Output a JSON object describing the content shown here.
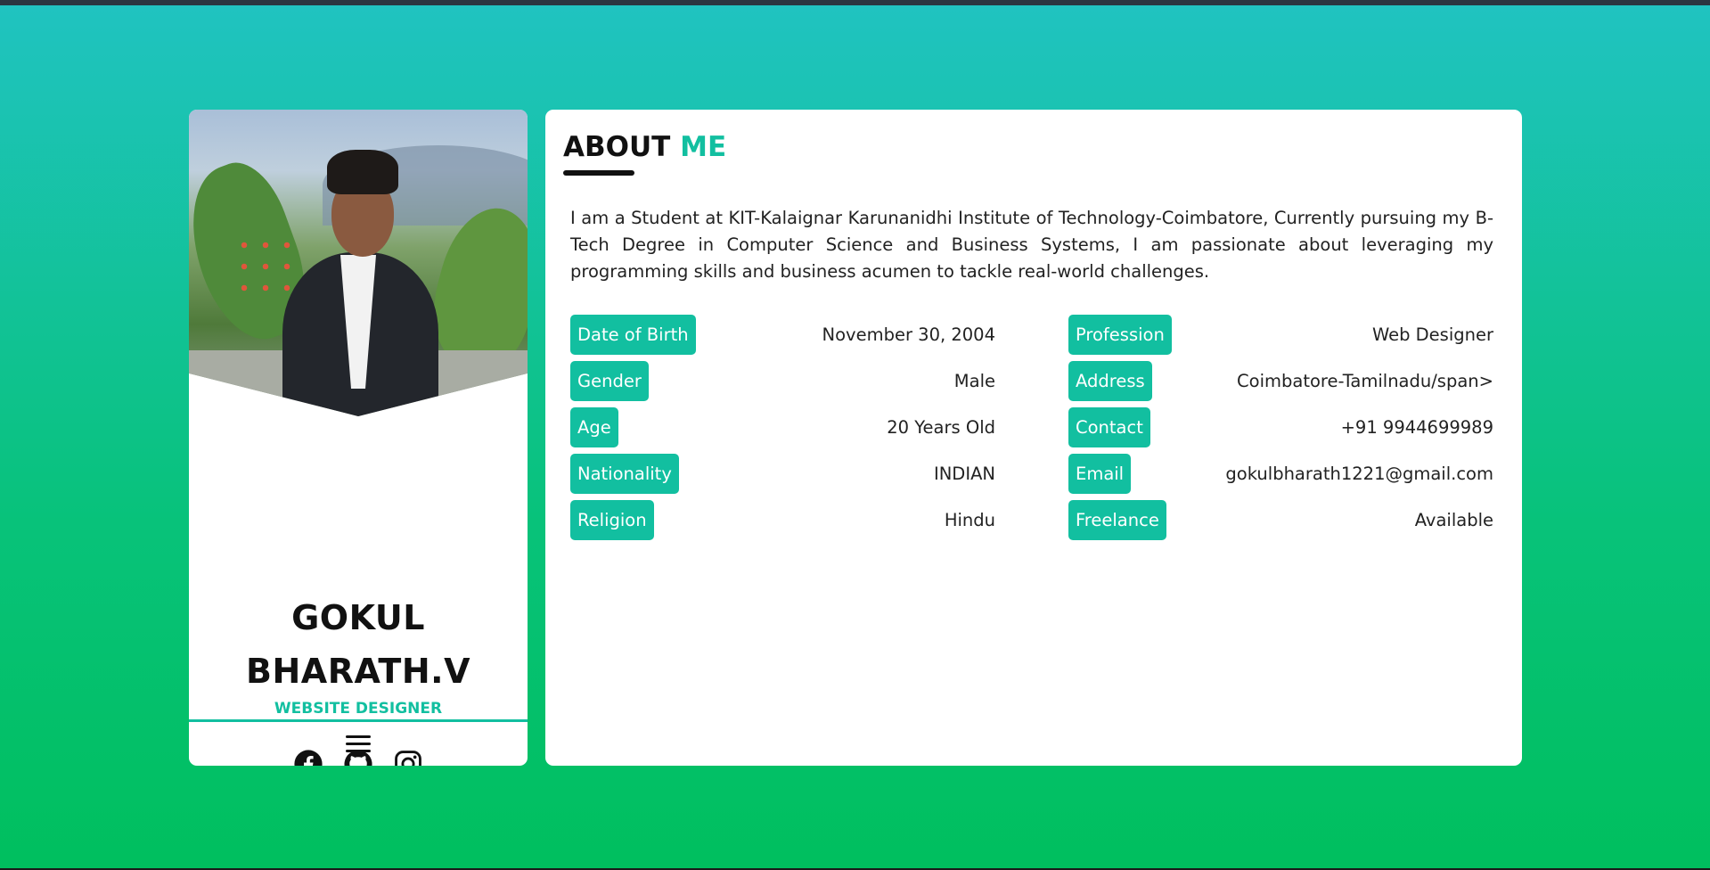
{
  "colors": {
    "accent": "#12bfa0",
    "text": "#111111",
    "card": "#ffffff",
    "gradient_top": "#20c3c1",
    "gradient_bottom": "#00bf5e"
  },
  "profile": {
    "name": "GOKUL BHARATH.V",
    "role": "WEBSITE DESIGNER",
    "socials": [
      {
        "name": "facebook-icon"
      },
      {
        "name": "github-icon"
      },
      {
        "name": "instagram-icon"
      }
    ],
    "menu_icon": "hamburger-menu-icon"
  },
  "about": {
    "title_main": "ABOUT",
    "title_accent": "ME",
    "bio": "I am a Student at KIT-Kalaignar Karunanidhi Institute of Technology-Coimbatore, Currently pursuing my B-Tech Degree in Computer Science and Business Systems, I am passionate about leveraging my programming skills and business acumen to tackle real-world challenges.",
    "left": [
      {
        "label": "Date of Birth",
        "value": "November 30, 2004"
      },
      {
        "label": "Gender",
        "value": "Male"
      },
      {
        "label": "Age",
        "value": "20 Years Old"
      },
      {
        "label": "Nationality",
        "value": "INDIAN"
      },
      {
        "label": "Religion",
        "value": "Hindu"
      }
    ],
    "right": [
      {
        "label": "Profession",
        "value": "Web Designer"
      },
      {
        "label": "Address",
        "value": "Coimbatore-Tamilnadu/span>"
      },
      {
        "label": "Contact",
        "value": "+91 9944699989"
      },
      {
        "label": "Email",
        "value": "gokulbharath1221@gmail.com"
      },
      {
        "label": "Freelance",
        "value": "Available"
      }
    ]
  }
}
